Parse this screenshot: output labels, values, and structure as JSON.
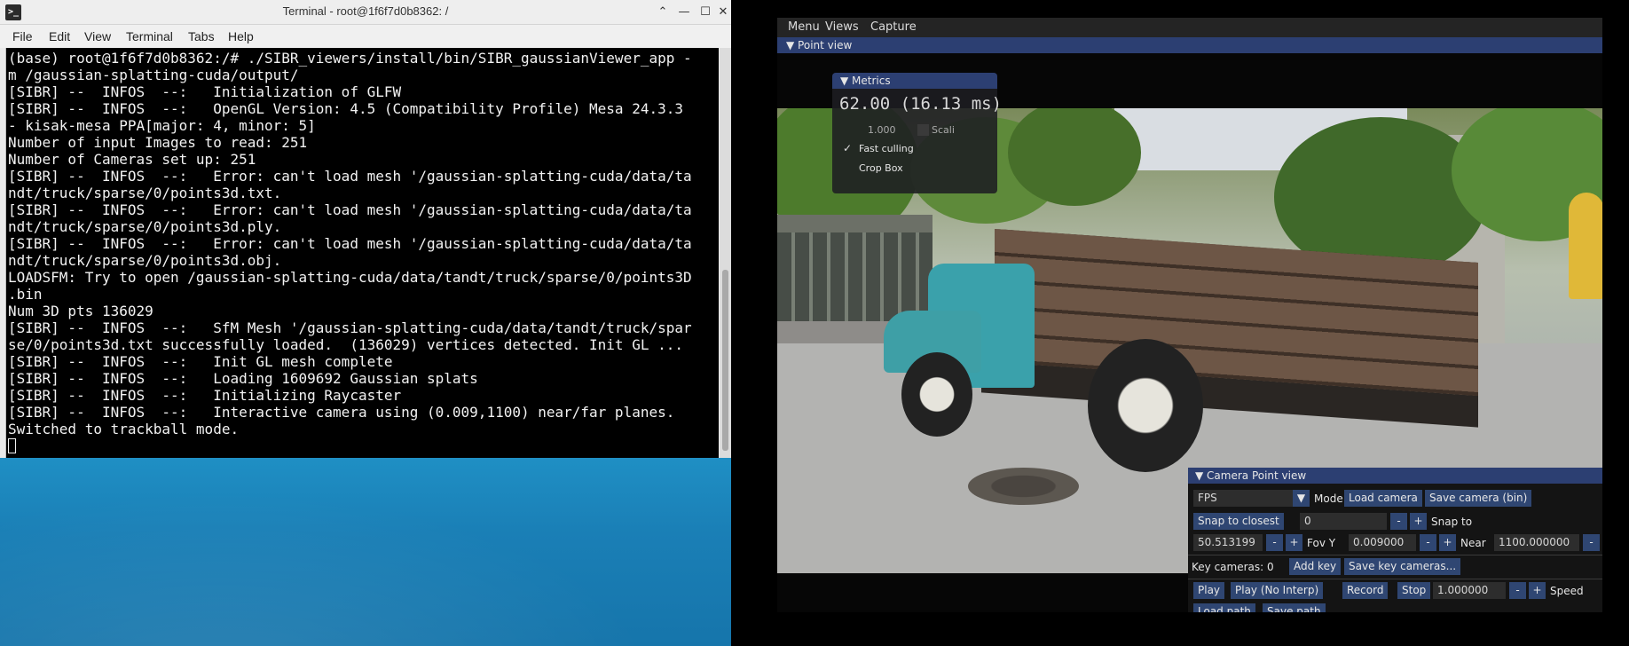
{
  "terminal": {
    "title": "Terminal - root@1f6f7d0b8362: /",
    "app_icon": "terminal-icon",
    "menu": [
      "File",
      "Edit",
      "View",
      "Terminal",
      "Tabs",
      "Help"
    ],
    "lines": [
      "(base) root@1f6f7d0b8362:/# ./SIBR_viewers/install/bin/SIBR_gaussianViewer_app -",
      "m /gaussian-splatting-cuda/output/",
      "[SIBR] --  INFOS  --:   Initialization of GLFW",
      "[SIBR] --  INFOS  --:   OpenGL Version: 4.5 (Compatibility Profile) Mesa 24.3.3",
      "- kisak-mesa PPA[major: 4, minor: 5]",
      "Number of input Images to read: 251",
      "Number of Cameras set up: 251",
      "[SIBR] --  INFOS  --:   Error: can't load mesh '/gaussian-splatting-cuda/data/ta",
      "ndt/truck/sparse/0/points3d.txt.",
      "[SIBR] --  INFOS  --:   Error: can't load mesh '/gaussian-splatting-cuda/data/ta",
      "ndt/truck/sparse/0/points3d.ply.",
      "[SIBR] --  INFOS  --:   Error: can't load mesh '/gaussian-splatting-cuda/data/ta",
      "ndt/truck/sparse/0/points3d.obj.",
      "LOADSFM: Try to open /gaussian-splatting-cuda/data/tandt/truck/sparse/0/points3D",
      ".bin",
      "Num 3D pts 136029",
      "[SIBR] --  INFOS  --:   SfM Mesh '/gaussian-splatting-cuda/data/tandt/truck/spar",
      "se/0/points3d.txt successfully loaded.  (136029) vertices detected. Init GL ...",
      "[SIBR] --  INFOS  --:   Init GL mesh complete",
      "[SIBR] --  INFOS  --:   Loading 1609692 Gaussian splats",
      "[SIBR] --  INFOS  --:   Initializing Raycaster",
      "[SIBR] --  INFOS  --:   Interactive camera using (0.009,1100) near/far planes.",
      "Switched to trackball mode."
    ]
  },
  "viewer": {
    "menu": [
      "Menu",
      "Views",
      "Capture"
    ],
    "point_view_header": "▼ Point view",
    "metrics": {
      "header": "▼ Metrics",
      "fps_text": "62.00 (16.13 ms)",
      "scale_value": "1.000",
      "scaling_label": "Scali",
      "fast_culling": "Fast culling",
      "crop_box": "Crop Box"
    },
    "camera_panel": {
      "header": "▼ Camera Point view",
      "mode_value": "FPS",
      "mode_label": "Mode",
      "load_camera": "Load camera",
      "save_camera": "Save camera (bin)",
      "snap_to_closest": "Snap to closest",
      "snap_value": "0",
      "snap_to_label": "Snap to",
      "fov_value": "50.513199",
      "fov_label": "Fov Y",
      "near_value": "0.009000",
      "near_label": "Near",
      "far_value": "1100.000000",
      "key_cameras": "Key cameras: 0",
      "add_key": "Add key",
      "save_key_cameras": "Save key cameras...",
      "play": "Play",
      "play_no_interp": "Play (No Interp)",
      "record": "Record",
      "stop": "Stop",
      "speed_value": "1.000000",
      "speed_label": "Speed",
      "load_path": "Load path",
      "save_path": "Save path",
      "minus": "-",
      "plus": "+"
    }
  }
}
